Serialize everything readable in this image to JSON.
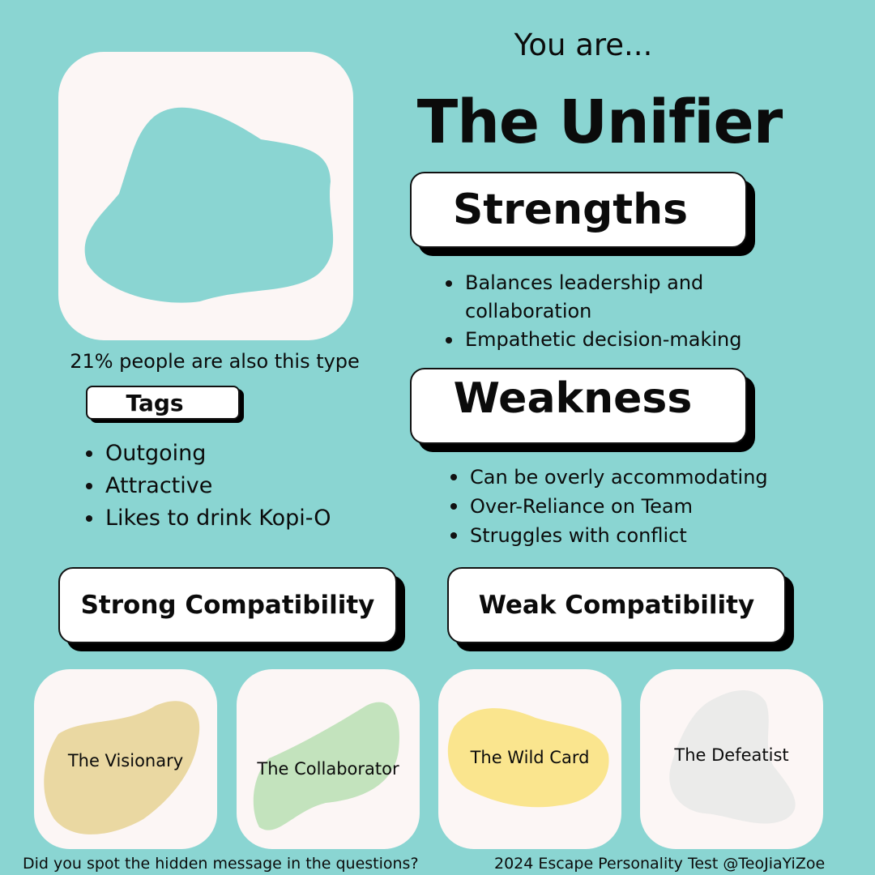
{
  "header": {
    "intro": "You are...",
    "type_name": "The Unifier"
  },
  "profile": {
    "percentage_text": "21% people are also this type",
    "blob_color": "#8ad5d2"
  },
  "tags": {
    "label": "Tags",
    "items": [
      "Outgoing",
      "Attractive",
      "Likes to drink Kopi-O"
    ]
  },
  "strengths": {
    "label": "Strengths",
    "items": [
      "Balances leadership and collaboration",
      "Empathetic decision-making"
    ]
  },
  "weakness": {
    "label": "Weakness",
    "items": [
      "Can be overly accommodating",
      "Over-Reliance on Team",
      "Struggles with conflict"
    ]
  },
  "compatibility": {
    "strong_label": "Strong Compatibility",
    "weak_label": "Weak Compatibility",
    "strong": [
      {
        "name": "The Visionary",
        "color": "#ead8a2"
      },
      {
        "name": "The Collaborator",
        "color": "#c3e3bd"
      }
    ],
    "weak": [
      {
        "name": "The Wild Card",
        "color": "#fae58e"
      },
      {
        "name": "The Defeatist",
        "color": "#ebebea"
      }
    ]
  },
  "footer": {
    "left": "Did you spot the hidden message in the questions?",
    "right": "2024 Escape Personality Test @TeoJiaYiZoe"
  },
  "colors": {
    "background": "#8ad5d2",
    "card": "#fcf6f5",
    "text": "#0b0b0b"
  }
}
